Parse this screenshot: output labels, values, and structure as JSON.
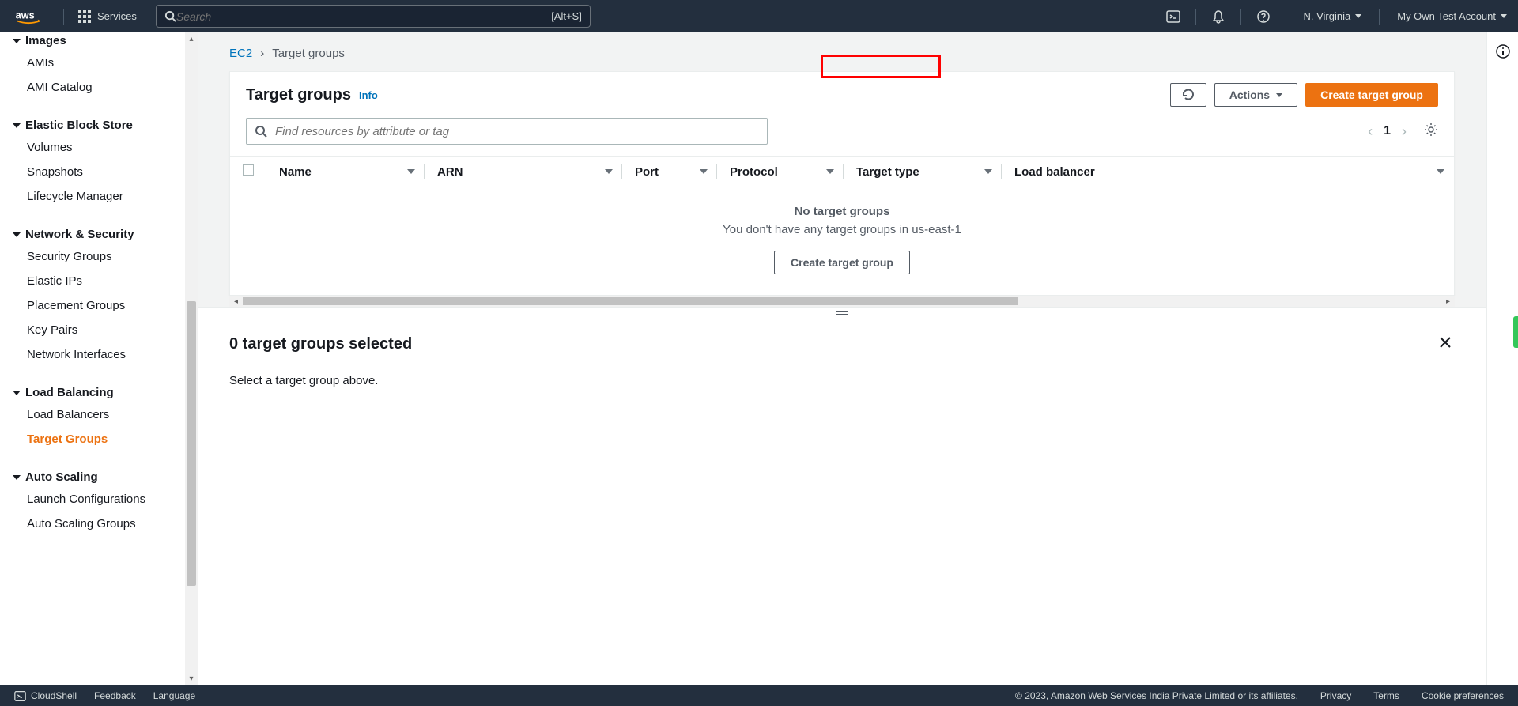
{
  "nav": {
    "services": "Services",
    "search_placeholder": "Search",
    "search_shortcut": "[Alt+S]",
    "region": "N. Virginia",
    "account": "My Own Test Account"
  },
  "sidebar": {
    "images": {
      "header": "Images",
      "items": [
        "AMIs",
        "AMI Catalog"
      ]
    },
    "ebs": {
      "header": "Elastic Block Store",
      "items": [
        "Volumes",
        "Snapshots",
        "Lifecycle Manager"
      ]
    },
    "net": {
      "header": "Network & Security",
      "items": [
        "Security Groups",
        "Elastic IPs",
        "Placement Groups",
        "Key Pairs",
        "Network Interfaces"
      ]
    },
    "lb": {
      "header": "Load Balancing",
      "items": [
        "Load Balancers",
        "Target Groups"
      ]
    },
    "as": {
      "header": "Auto Scaling",
      "items": [
        "Launch Configurations",
        "Auto Scaling Groups"
      ]
    }
  },
  "breadcrumb": {
    "root": "EC2",
    "current": "Target groups"
  },
  "panel": {
    "title": "Target groups",
    "info": "Info",
    "actions": "Actions",
    "create": "Create target group",
    "filter_placeholder": "Find resources by attribute or tag",
    "page": "1"
  },
  "columns": {
    "name": "Name",
    "arn": "ARN",
    "port": "Port",
    "protocol": "Protocol",
    "target_type": "Target type",
    "load_balancer": "Load balancer"
  },
  "empty": {
    "title": "No target groups",
    "text": "You don't have any target groups in us-east-1",
    "button": "Create target group"
  },
  "detail": {
    "title": "0 target groups selected",
    "text": "Select a target group above."
  },
  "footer": {
    "cloudshell": "CloudShell",
    "feedback": "Feedback",
    "language": "Language",
    "copyright": "© 2023, Amazon Web Services India Private Limited or its affiliates.",
    "privacy": "Privacy",
    "terms": "Terms",
    "cookie": "Cookie preferences"
  }
}
